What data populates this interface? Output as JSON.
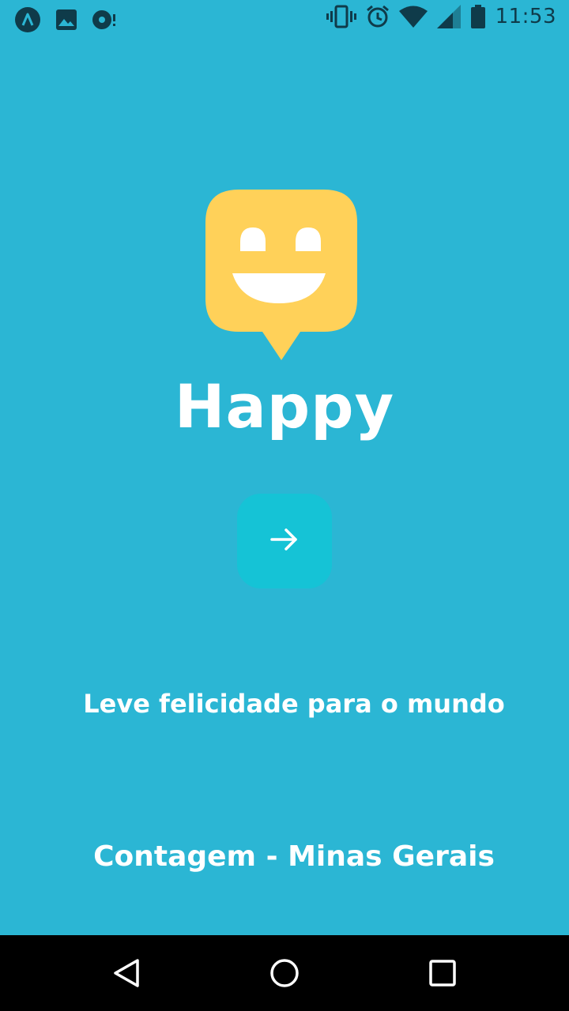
{
  "status_bar": {
    "time": "11:53",
    "left_icons": [
      "app-a-icon",
      "image-icon",
      "media-icon"
    ],
    "right_icons": [
      "vibrate-icon",
      "alarm-icon",
      "wifi-icon",
      "signal-icon",
      "battery-icon"
    ]
  },
  "app": {
    "title": "Happy",
    "tagline": "Leve felicidade para o mundo",
    "location": "Contagem - Minas Gerais"
  },
  "colors": {
    "background": "#2bb6d4",
    "button": "#15c3d6",
    "logo": "#ffd159",
    "text": "#ffffff"
  },
  "nav": {
    "buttons": [
      "back",
      "home",
      "recents"
    ]
  }
}
